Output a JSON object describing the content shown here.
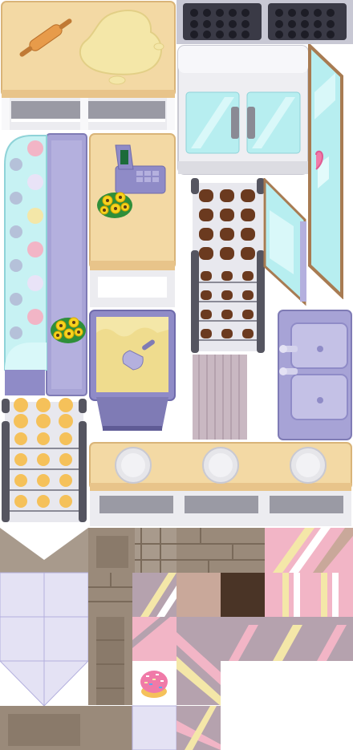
{
  "sheet": {
    "kind": "bakery-kitchen-tileset",
    "tiles": [
      {
        "id": "dough-table",
        "icon": "rolling-pin-icon"
      },
      {
        "id": "baking-trays"
      },
      {
        "id": "double-door-fridge"
      },
      {
        "id": "open-fridge-door"
      },
      {
        "id": "cake-display-case"
      },
      {
        "id": "cash-register-counter",
        "icon": "cash-register-icon"
      },
      {
        "id": "flower-pot",
        "icon": "sunflower-icon"
      },
      {
        "id": "chocolate-muffin-rack"
      },
      {
        "id": "flour-bin",
        "icon": "flour-scoop-icon"
      },
      {
        "id": "floor-mat"
      },
      {
        "id": "double-sink"
      },
      {
        "id": "golden-muffin-rack"
      },
      {
        "id": "plate-counter"
      },
      {
        "id": "wall-and-floor-tiles"
      },
      {
        "id": "frosted-donut",
        "icon": "donut-icon"
      }
    ]
  },
  "palette": {
    "wood": "#f3d9a4",
    "wood_dark": "#d9b478",
    "steel": "#e6e6ea",
    "lavender": "#a7a3d6",
    "lavender_dark": "#7f7bb5",
    "glass": "#b7eef0",
    "chocolate": "#6b3a1f",
    "golden": "#f5c15a",
    "brick": "#9a8a7a",
    "pink": "#f2b5c6",
    "cream": "#f4e7a8",
    "dark_rack": "#555560"
  }
}
